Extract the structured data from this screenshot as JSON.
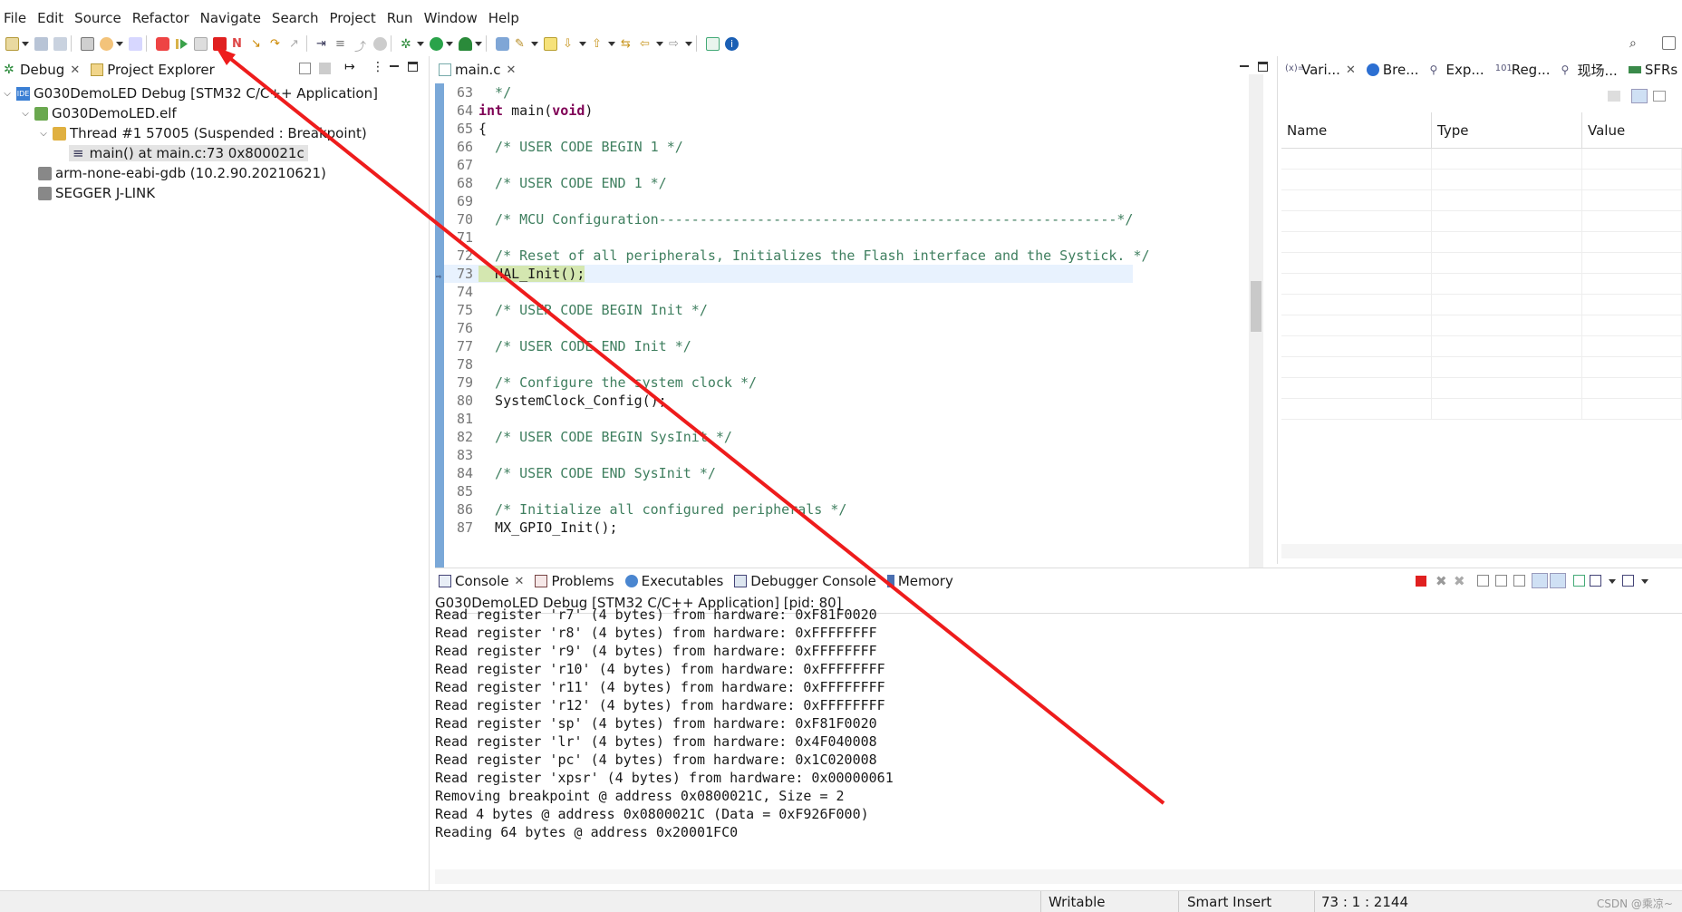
{
  "menu": [
    "File",
    "Edit",
    "Source",
    "Refactor",
    "Navigate",
    "Search",
    "Project",
    "Run",
    "Window",
    "Help"
  ],
  "left_tabs": {
    "debug": "Debug",
    "project_explorer": "Project Explorer"
  },
  "tree": [
    {
      "label": "G030DemoLED Debug [STM32 C/C++ Application]"
    },
    {
      "label": "G030DemoLED.elf"
    },
    {
      "label": "Thread #1 57005 (Suspended : Breakpoint)"
    },
    {
      "label": "main() at main.c:73 0x800021c"
    },
    {
      "label": "arm-none-eabi-gdb (10.2.90.20210621)"
    },
    {
      "label": "SEGGER J-LINK"
    }
  ],
  "editor": {
    "tab": "main.c",
    "current_line": "73",
    "lines": [
      {
        "n": "63",
        "code": "  */"
      },
      {
        "n": "64",
        "code": "int main(void)"
      },
      {
        "n": "65",
        "code": "{"
      },
      {
        "n": "66",
        "code": "  /* USER CODE BEGIN 1 */"
      },
      {
        "n": "67",
        "code": ""
      },
      {
        "n": "68",
        "code": "  /* USER CODE END 1 */"
      },
      {
        "n": "69",
        "code": ""
      },
      {
        "n": "70",
        "code": "  /* MCU Configuration--------------------------------------------------------*/"
      },
      {
        "n": "71",
        "code": ""
      },
      {
        "n": "72",
        "code": "  /* Reset of all peripherals, Initializes the Flash interface and the Systick. */"
      },
      {
        "n": "73",
        "code": "  HAL_Init();"
      },
      {
        "n": "74",
        "code": ""
      },
      {
        "n": "75",
        "code": "  /* USER CODE BEGIN Init */"
      },
      {
        "n": "76",
        "code": ""
      },
      {
        "n": "77",
        "code": "  /* USER CODE END Init */"
      },
      {
        "n": "78",
        "code": ""
      },
      {
        "n": "79",
        "code": "  /* Configure the system clock */"
      },
      {
        "n": "80",
        "code": "  SystemClock_Config();"
      },
      {
        "n": "81",
        "code": ""
      },
      {
        "n": "82",
        "code": "  /* USER CODE BEGIN SysInit */"
      },
      {
        "n": "83",
        "code": ""
      },
      {
        "n": "84",
        "code": "  /* USER CODE END SysInit */"
      },
      {
        "n": "85",
        "code": ""
      },
      {
        "n": "86",
        "code": "  /* Initialize all configured peripherals */"
      },
      {
        "n": "87",
        "code": "  MX_GPIO_Init();"
      }
    ]
  },
  "right_tabs": [
    "Vari...",
    "Bre...",
    "Exp...",
    "Reg...",
    "现场...",
    "SFRs"
  ],
  "variables": {
    "headers": [
      "Name",
      "Type",
      "Value"
    ]
  },
  "bottom_tabs": [
    "Console",
    "Problems",
    "Executables",
    "Debugger Console",
    "Memory"
  ],
  "console": {
    "title": "G030DemoLED Debug [STM32 C/C++ Application]  [pid: 80]",
    "lines": [
      "Read register 'r7' (4 bytes) from hardware: 0xF81F0020",
      "Read register 'r8' (4 bytes) from hardware: 0xFFFFFFFF",
      "Read register 'r9' (4 bytes) from hardware: 0xFFFFFFFF",
      "Read register 'r10' (4 bytes) from hardware: 0xFFFFFFFF",
      "Read register 'r11' (4 bytes) from hardware: 0xFFFFFFFF",
      "Read register 'r12' (4 bytes) from hardware: 0xFFFFFFFF",
      "Read register 'sp' (4 bytes) from hardware: 0xF81F0020",
      "Read register 'lr' (4 bytes) from hardware: 0x4F040008",
      "Read register 'pc' (4 bytes) from hardware: 0x1C020008",
      "Read register 'xpsr' (4 bytes) from hardware: 0x00000061",
      "Removing breakpoint @ address 0x0800021C, Size = 2",
      "Read 4 bytes @ address 0x0800021C (Data = 0xF926F000)",
      "Reading 64 bytes @ address 0x20001FC0"
    ]
  },
  "status": {
    "writable": "Writable",
    "insert": "Smart Insert",
    "position": "73 : 1 : 2144",
    "watermark": "CSDN @乘凉~"
  },
  "colors": {
    "annotation_arrow": "#ee1c1c",
    "gutter": "#cfe0f2",
    "current_line": "#e8f2fe"
  }
}
